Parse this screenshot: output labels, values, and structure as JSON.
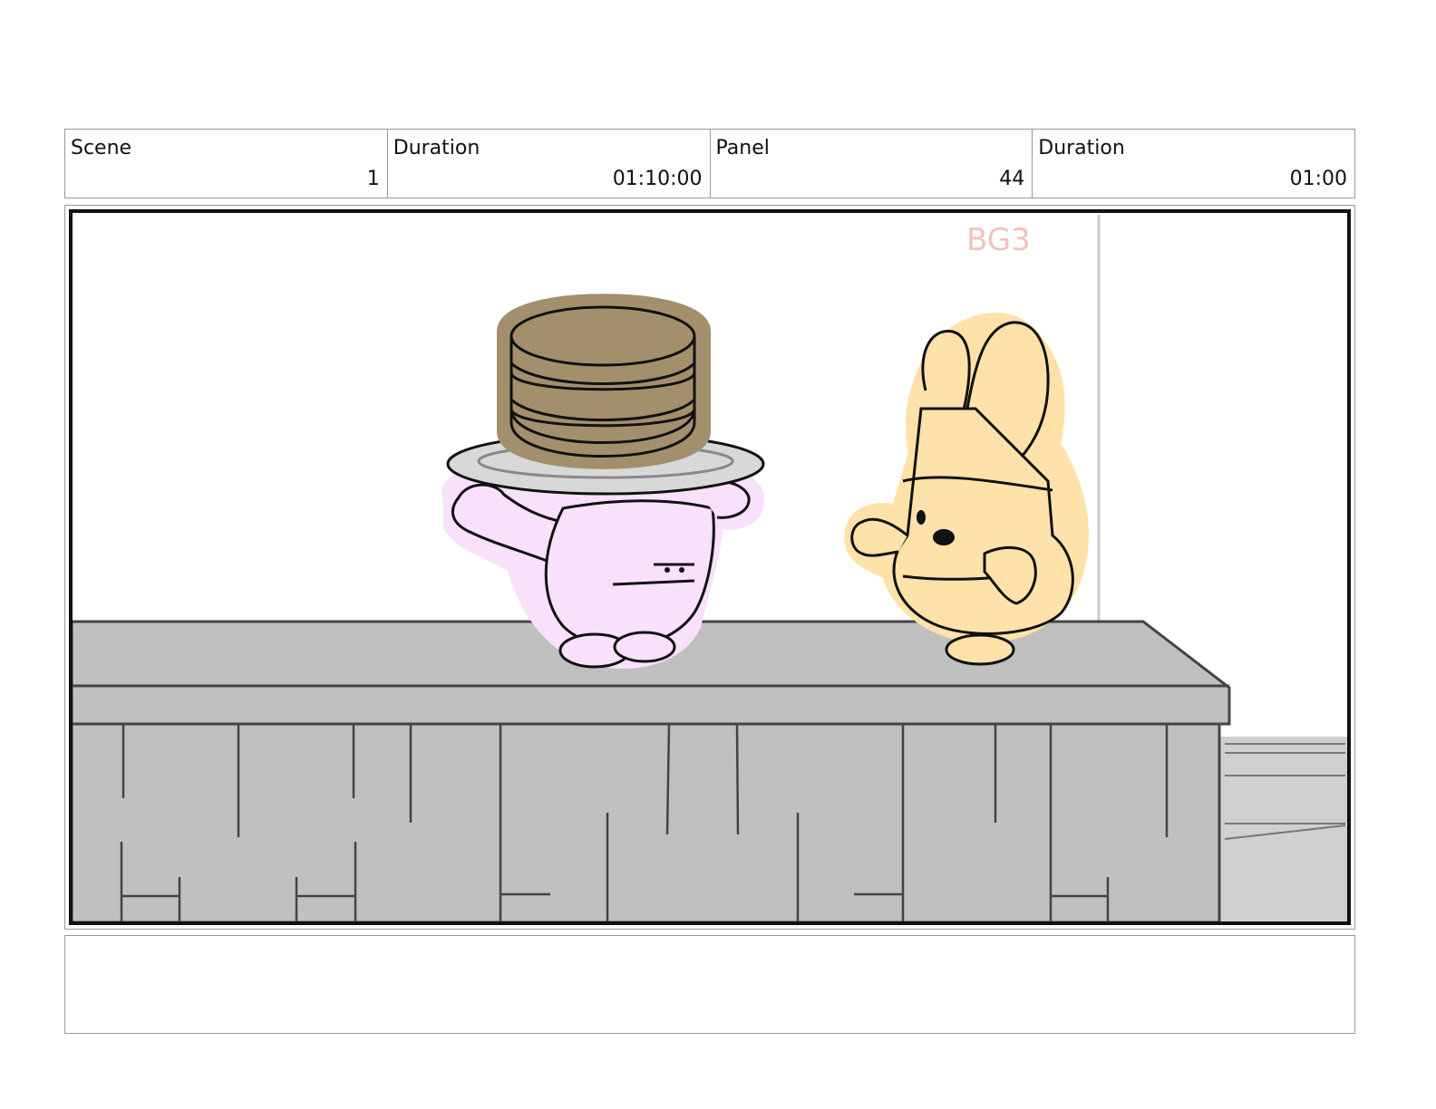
{
  "header": [
    {
      "label": "Scene",
      "value": "1"
    },
    {
      "label": "Duration",
      "value": "01:10:00"
    },
    {
      "label": "Panel",
      "value": "44"
    },
    {
      "label": "Duration",
      "value": "01:00"
    }
  ],
  "panel": {
    "annotation": "BG3"
  },
  "notes": {
    "text": ""
  },
  "colors": {
    "counter": "#c0c0c0",
    "pink_character": "#f9e0fb",
    "yellow_character": "#ffe2aa",
    "pancakes": "#a48f6d",
    "annotation": "#f2c2bd"
  }
}
